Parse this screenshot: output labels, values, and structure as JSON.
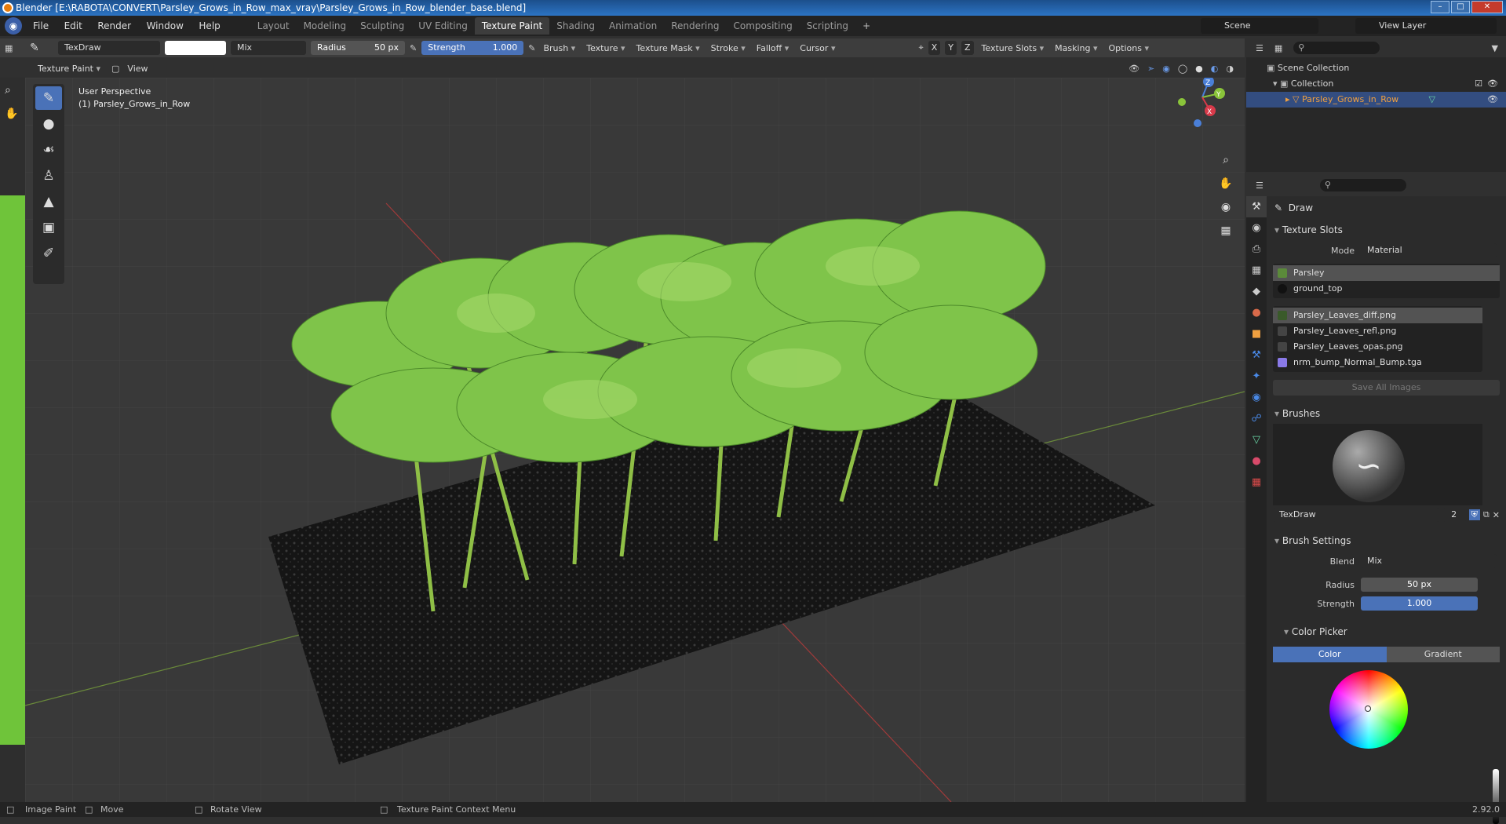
{
  "window": {
    "title": "Blender [E:\\RABOTA\\CONVERT\\Parsley_Grows_in_Row_max_vray\\Parsley_Grows_in_Row_blender_base.blend]"
  },
  "menu": [
    "File",
    "Edit",
    "Render",
    "Window",
    "Help"
  ],
  "workspaces": [
    {
      "label": "Layout",
      "active": false
    },
    {
      "label": "Modeling",
      "active": false
    },
    {
      "label": "Sculpting",
      "active": false
    },
    {
      "label": "UV Editing",
      "active": false
    },
    {
      "label": "Texture Paint",
      "active": true
    },
    {
      "label": "Shading",
      "active": false
    },
    {
      "label": "Animation",
      "active": false
    },
    {
      "label": "Rendering",
      "active": false
    },
    {
      "label": "Compositing",
      "active": false
    },
    {
      "label": "Scripting",
      "active": false
    }
  ],
  "workspace_add": "+",
  "scene": "Scene",
  "view_layer": "View Layer",
  "tool_header": {
    "brush_name": "TexDraw",
    "blend": "Mix",
    "radius_label": "Radius",
    "radius_value": "50 px",
    "strength_label": "Strength",
    "strength_value": "1.000",
    "menus": [
      "Brush",
      "Texture",
      "Texture Mask",
      "Stroke",
      "Falloff",
      "Cursor"
    ],
    "axes": [
      "X",
      "Y",
      "Z"
    ],
    "right_menus": [
      "Texture Slots",
      "Masking",
      "Options"
    ]
  },
  "view_header": {
    "mode": "Texture Paint",
    "view": "View"
  },
  "viewport": {
    "perspective": "User Perspective",
    "object": "(1) Parsley_Grows_in_Row"
  },
  "gizmo": {
    "z": "Z",
    "y": "Y",
    "x": "X"
  },
  "outliner": {
    "scene_collection": "Scene Collection",
    "collection": "Collection",
    "object": "Parsley_Grows_in_Row"
  },
  "properties": {
    "tool_name": "Draw",
    "texture_slots": {
      "title": "Texture Slots",
      "mode_label": "Mode",
      "mode_value": "Material",
      "materials": [
        {
          "name": "Parsley",
          "selected": true,
          "color": "#5b8a3a"
        },
        {
          "name": "ground_top",
          "selected": false,
          "color": "#111111"
        }
      ],
      "images": [
        {
          "name": "Parsley_Leaves_diff.png",
          "selected": true
        },
        {
          "name": "Parsley_Leaves_refl.png",
          "selected": false
        },
        {
          "name": "Parsley_Leaves_opas.png",
          "selected": false
        },
        {
          "name": "nrm_bump_Normal_Bump.tga",
          "selected": false
        }
      ],
      "save_all": "Save All Images"
    },
    "brushes": {
      "title": "Brushes",
      "brush_name": "TexDraw",
      "users": "2"
    },
    "brush_settings": {
      "title": "Brush Settings",
      "blend_label": "Blend",
      "blend_value": "Mix",
      "radius_label": "Radius",
      "radius_value": "50 px",
      "strength_label": "Strength",
      "strength_value": "1.000"
    },
    "color_picker": {
      "title": "Color Picker",
      "color_tab": "Color",
      "gradient_tab": "Gradient"
    }
  },
  "statusbar": {
    "image_paint": "Image Paint",
    "move": "Move",
    "rotate_view": "Rotate View",
    "context_menu": "Texture Paint Context Menu",
    "version": "2.92.0"
  },
  "colors": {
    "accent": "#4a72b8",
    "selected_object": "#f0a040",
    "leaf_green": "#7fc44a"
  }
}
